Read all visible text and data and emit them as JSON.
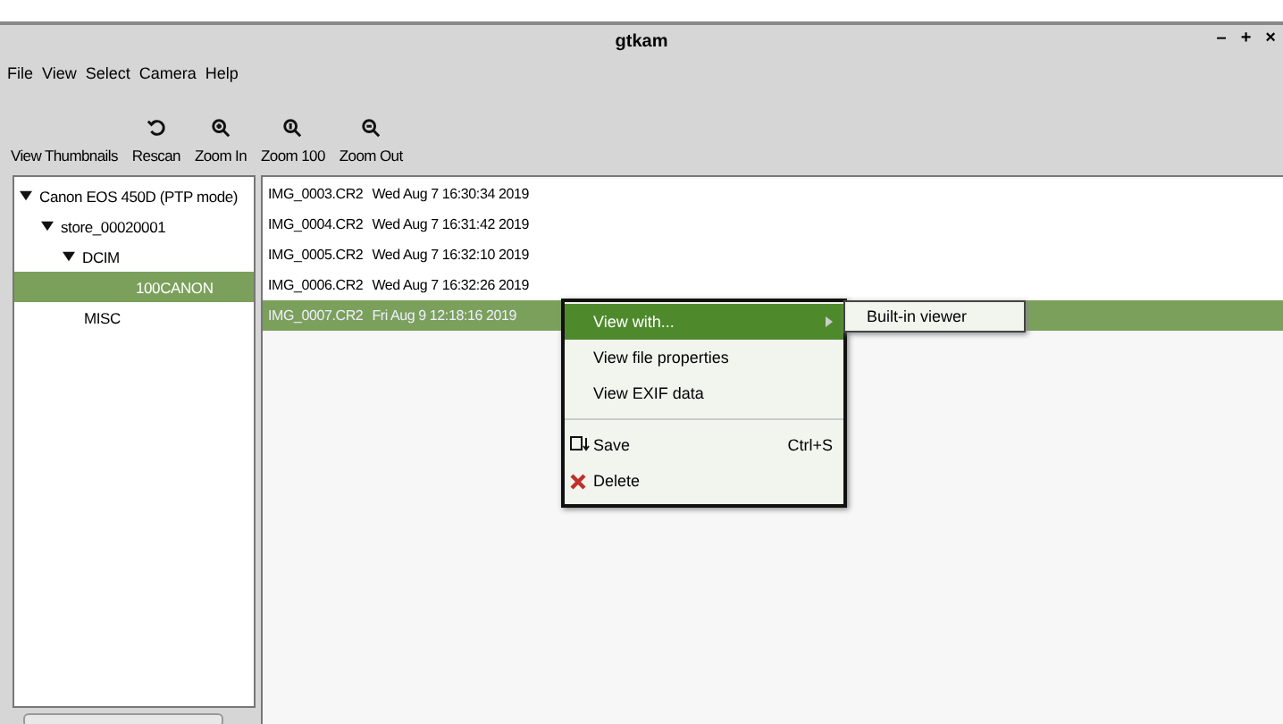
{
  "window": {
    "title": "gtkam",
    "controls": [
      "–",
      "+",
      "×"
    ]
  },
  "menu_bar": [
    "File",
    "View",
    "Select",
    "Camera",
    "Help"
  ],
  "toolbar": [
    {
      "label": "View Thumbnails",
      "kind": "text"
    },
    {
      "label": "Rescan",
      "kind": "rescan"
    },
    {
      "label": "Zoom In",
      "kind": "zoom_in"
    },
    {
      "label": "Zoom 100",
      "kind": "zoom_100"
    },
    {
      "label": "Zoom Out",
      "kind": "zoom_out"
    }
  ],
  "tree": [
    {
      "label": "Canon EOS 450D (PTP mode)",
      "expanded": true,
      "selected": false,
      "children": [
        {
          "label": "store_00020001",
          "expanded": true,
          "selected": false,
          "children": [
            {
              "label": "DCIM",
              "expanded": true,
              "selected": false,
              "children": [
                {
                  "label": "100CANON",
                  "selected": true
                }
              ]
            },
            {
              "label": "MISC",
              "selected": false
            }
          ]
        }
      ]
    }
  ],
  "files": [
    {
      "name": "IMG_0003.CR2",
      "date": "Wed Aug  7 16:30:34 2019",
      "selected": false
    },
    {
      "name": "IMG_0004.CR2",
      "date": "Wed Aug  7 16:31:42 2019",
      "selected": false
    },
    {
      "name": "IMG_0005.CR2",
      "date": "Wed Aug  7 16:32:10 2019",
      "selected": false
    },
    {
      "name": "IMG_0006.CR2",
      "date": "Wed Aug  7 16:32:26 2019",
      "selected": false
    },
    {
      "name": "IMG_0007.CR2",
      "date": "Fri Aug  9 12:18:16 2019",
      "selected": true
    }
  ],
  "context_menu": [
    {
      "label": "View with...",
      "kind": "submenu",
      "selected": true
    },
    {
      "label": "View file properties",
      "kind": "plain",
      "selected": false
    },
    {
      "label": "View EXIF data",
      "kind": "plain",
      "selected": false
    },
    {
      "kind": "separator"
    },
    {
      "label": "Save",
      "kind": "save",
      "shortcut": "Ctrl+S",
      "selected": false
    },
    {
      "label": "Delete",
      "kind": "delete",
      "selected": false
    }
  ],
  "submenu": [
    {
      "label": "Built-in viewer",
      "selected": false
    }
  ]
}
